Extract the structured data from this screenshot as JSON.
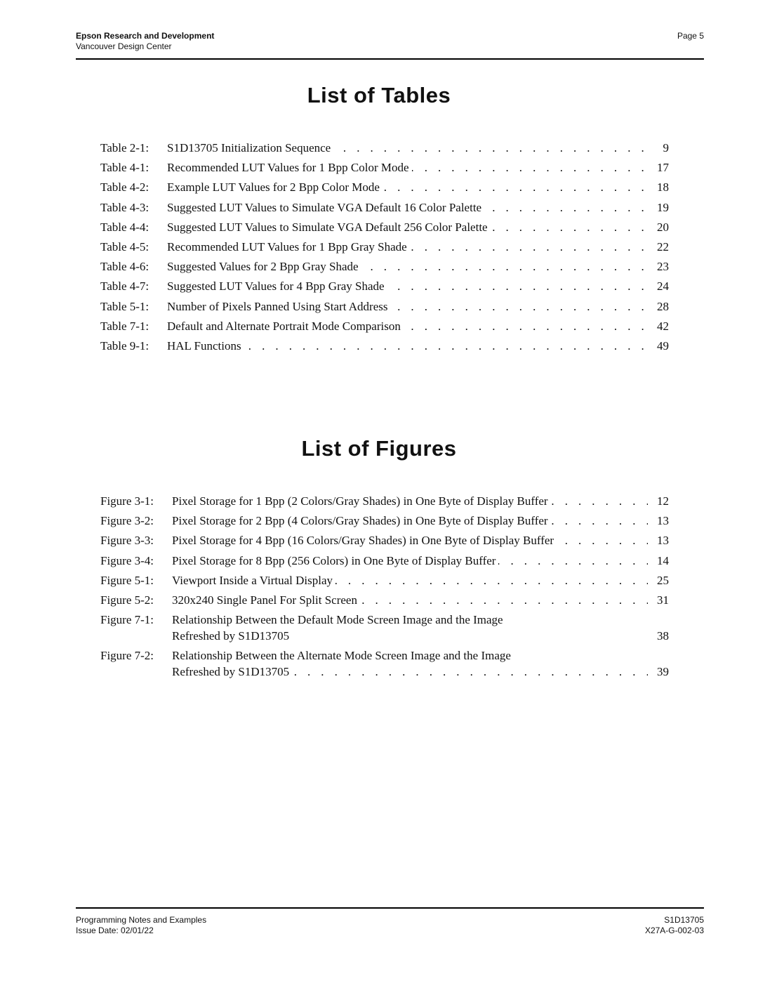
{
  "header": {
    "company": "Epson Research and Development",
    "division": "Vancouver Design Center",
    "page": "Page 5"
  },
  "tables_section": {
    "title": "List of Tables",
    "entries": [
      {
        "label": "Table 2-1:",
        "text": "S1D13705 Initialization Sequence",
        "page": "9"
      },
      {
        "label": "Table 4-1:",
        "text": "Recommended LUT Values for 1 Bpp Color Mode",
        "page": "17"
      },
      {
        "label": "Table 4-2:",
        "text": "Example LUT Values for 2 Bpp Color Mode",
        "page": "18"
      },
      {
        "label": "Table 4-3:",
        "text": "Suggested LUT Values to Simulate VGA Default 16 Color Palette",
        "page": "19"
      },
      {
        "label": "Table 4-4:",
        "text": "Suggested LUT Values to Simulate VGA Default 256 Color Palette",
        "page": "20"
      },
      {
        "label": "Table 4-5:",
        "text": "Recommended LUT Values for 1 Bpp Gray Shade",
        "page": "22"
      },
      {
        "label": "Table 4-6:",
        "text": "Suggested Values for 2 Bpp Gray Shade",
        "page": "23"
      },
      {
        "label": "Table 4-7:",
        "text": "Suggested LUT Values for 4 Bpp Gray Shade",
        "page": "24"
      },
      {
        "label": "Table 5-1:",
        "text": "Number of Pixels Panned Using Start Address",
        "page": "28"
      },
      {
        "label": "Table 7-1:",
        "text": "Default and Alternate Portrait Mode Comparison",
        "page": "42"
      },
      {
        "label": "Table 9-1:",
        "text": "HAL Functions",
        "page": "49"
      }
    ]
  },
  "figures_section": {
    "title": "List of Figures",
    "entries": [
      {
        "label": "Figure 3-1:",
        "text": "Pixel Storage for 1 Bpp (2 Colors/Gray Shades) in One Byte of Display Buffer",
        "page": "12"
      },
      {
        "label": "Figure 3-2:",
        "text": "Pixel Storage for 2 Bpp (4 Colors/Gray Shades) in One Byte of Display Buffer",
        "page": "13"
      },
      {
        "label": "Figure 3-3:",
        "text": "Pixel Storage for 4 Bpp (16 Colors/Gray Shades) in One Byte of Display Buffer",
        "page": "13"
      },
      {
        "label": "Figure 3-4:",
        "text": "Pixel Storage for 8 Bpp (256 Colors) in One Byte of Display Buffer",
        "page": "14"
      },
      {
        "label": "Figure 5-1:",
        "text": "Viewport Inside a Virtual Display",
        "page": "25"
      },
      {
        "label": "Figure 5-2:",
        "text": "320x240 Single Panel For Split Screen",
        "page": "31"
      },
      {
        "label": "Figure 7-1:",
        "text": "Relationship Between the Default Mode Screen Image and the Image",
        "text2": "Refreshed by S1D13705",
        "page": "38",
        "dots": false
      },
      {
        "label": "Figure 7-2:",
        "text": "Relationship Between the Alternate Mode Screen Image and the Image",
        "text2": "Refreshed by S1D13705",
        "page": "39"
      }
    ]
  },
  "footer": {
    "doc_title": "Programming Notes and Examples",
    "issue_date": "Issue Date: 02/01/22",
    "product": "S1D13705",
    "doc_number": "X27A-G-002-03"
  }
}
